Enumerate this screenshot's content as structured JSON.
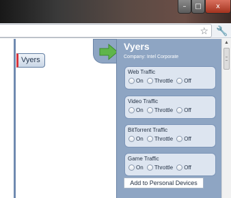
{
  "window": {
    "controls": {
      "minimize": "–",
      "maximize": "□",
      "close": "x"
    }
  },
  "toolbar": {
    "address_value": "",
    "star_icon": "☆",
    "wrench_icon": "🔧"
  },
  "content": {
    "tag_label": "Vyers"
  },
  "panel": {
    "name": "Vyers",
    "company": "Company: Intel Corporate",
    "groups": [
      {
        "title": "Web Traffic",
        "options": [
          "On",
          "Throttle",
          "Off"
        ]
      },
      {
        "title": "Video Traffic",
        "options": [
          "On",
          "Throttle",
          "Off"
        ]
      },
      {
        "title": "BitTorrent Traffic",
        "options": [
          "On",
          "Throttle",
          "Off"
        ]
      },
      {
        "title": "Game Traffic",
        "options": [
          "On",
          "Throttle",
          "Off"
        ]
      }
    ],
    "add_button_label": "Add to Personal Devices"
  },
  "colors": {
    "panel_bg": "#8ea5c3",
    "group_bg": "#dde5f0",
    "arrow_green": "#5fb54a",
    "tag_accent": "#d8343b"
  },
  "scrollbar": {
    "up_arrow": "▲"
  }
}
